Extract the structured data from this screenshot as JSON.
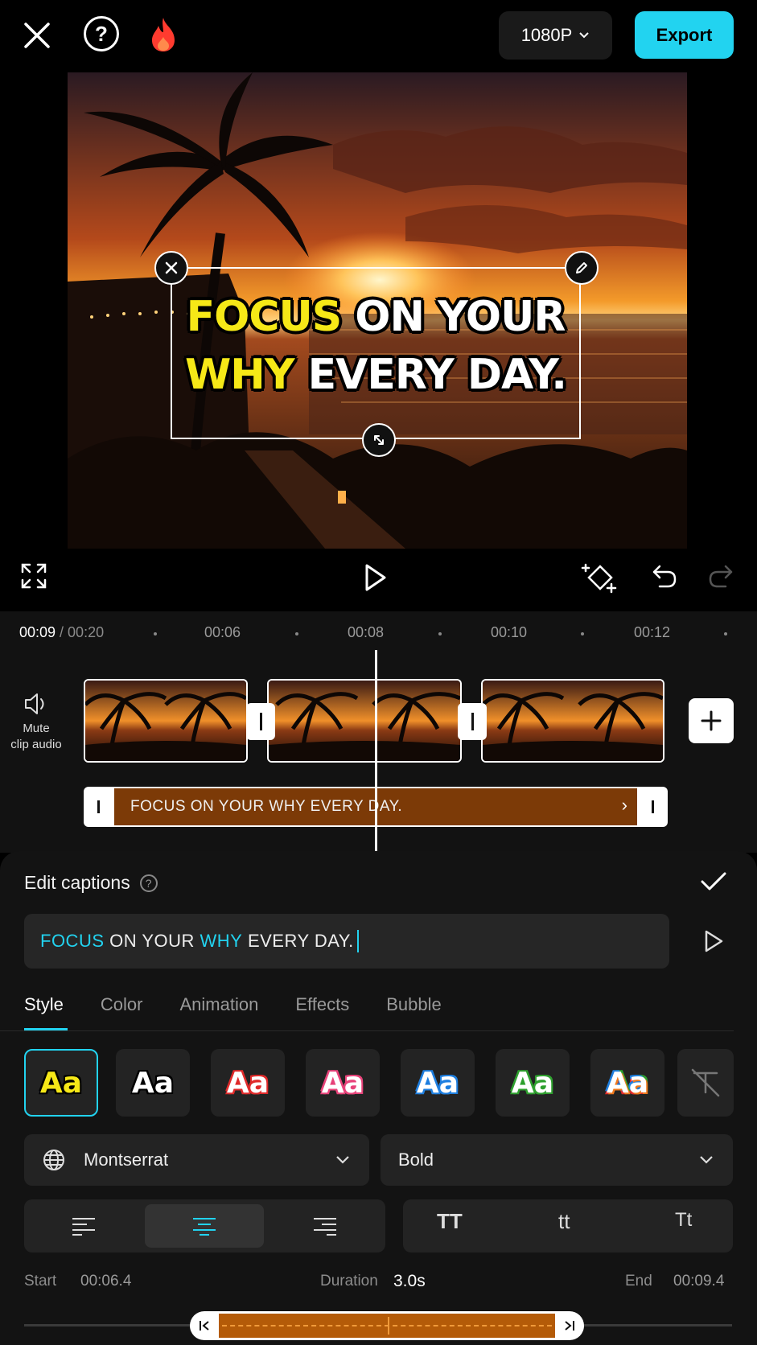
{
  "topbar": {
    "resolution": "1080P",
    "export_label": "Export"
  },
  "preview": {
    "caption_line1_highlight": "FOCUS",
    "caption_line1_rest": "ON YOUR",
    "caption_line2_highlight": "WHY",
    "caption_line2_rest": "EVERY DAY."
  },
  "timeline": {
    "current_time": "00:09",
    "total_time": " / 00:20",
    "ticks": [
      "00:06",
      "00:08",
      "00:10",
      "00:12"
    ],
    "mute_label_1": "Mute",
    "mute_label_2": "clip audio",
    "caption_clip_text": "FOCUS ON YOUR WHY EVERY DAY."
  },
  "edit_panel": {
    "title": "Edit captions",
    "input_highlight_1": "FOCUS",
    "input_mid_1": " ON YOUR ",
    "input_highlight_2": "WHY",
    "input_mid_2": " EVERY DAY.",
    "tabs": [
      "Style",
      "Color",
      "Animation",
      "Effects",
      "Bubble"
    ],
    "style_sample": "Aa",
    "font_name": "Montserrat",
    "font_weight": "Bold",
    "case_options": [
      "TT",
      "tt",
      "Tt"
    ],
    "start_label": "Start",
    "start_value": "00:06.4",
    "duration_label": "Duration",
    "duration_value": "3.0s",
    "end_label": "End",
    "end_value": "00:09.4"
  },
  "colors": {
    "accent": "#22d3f0",
    "caption_highlight": "#f6e817",
    "caption_track": "#7c3a07"
  }
}
